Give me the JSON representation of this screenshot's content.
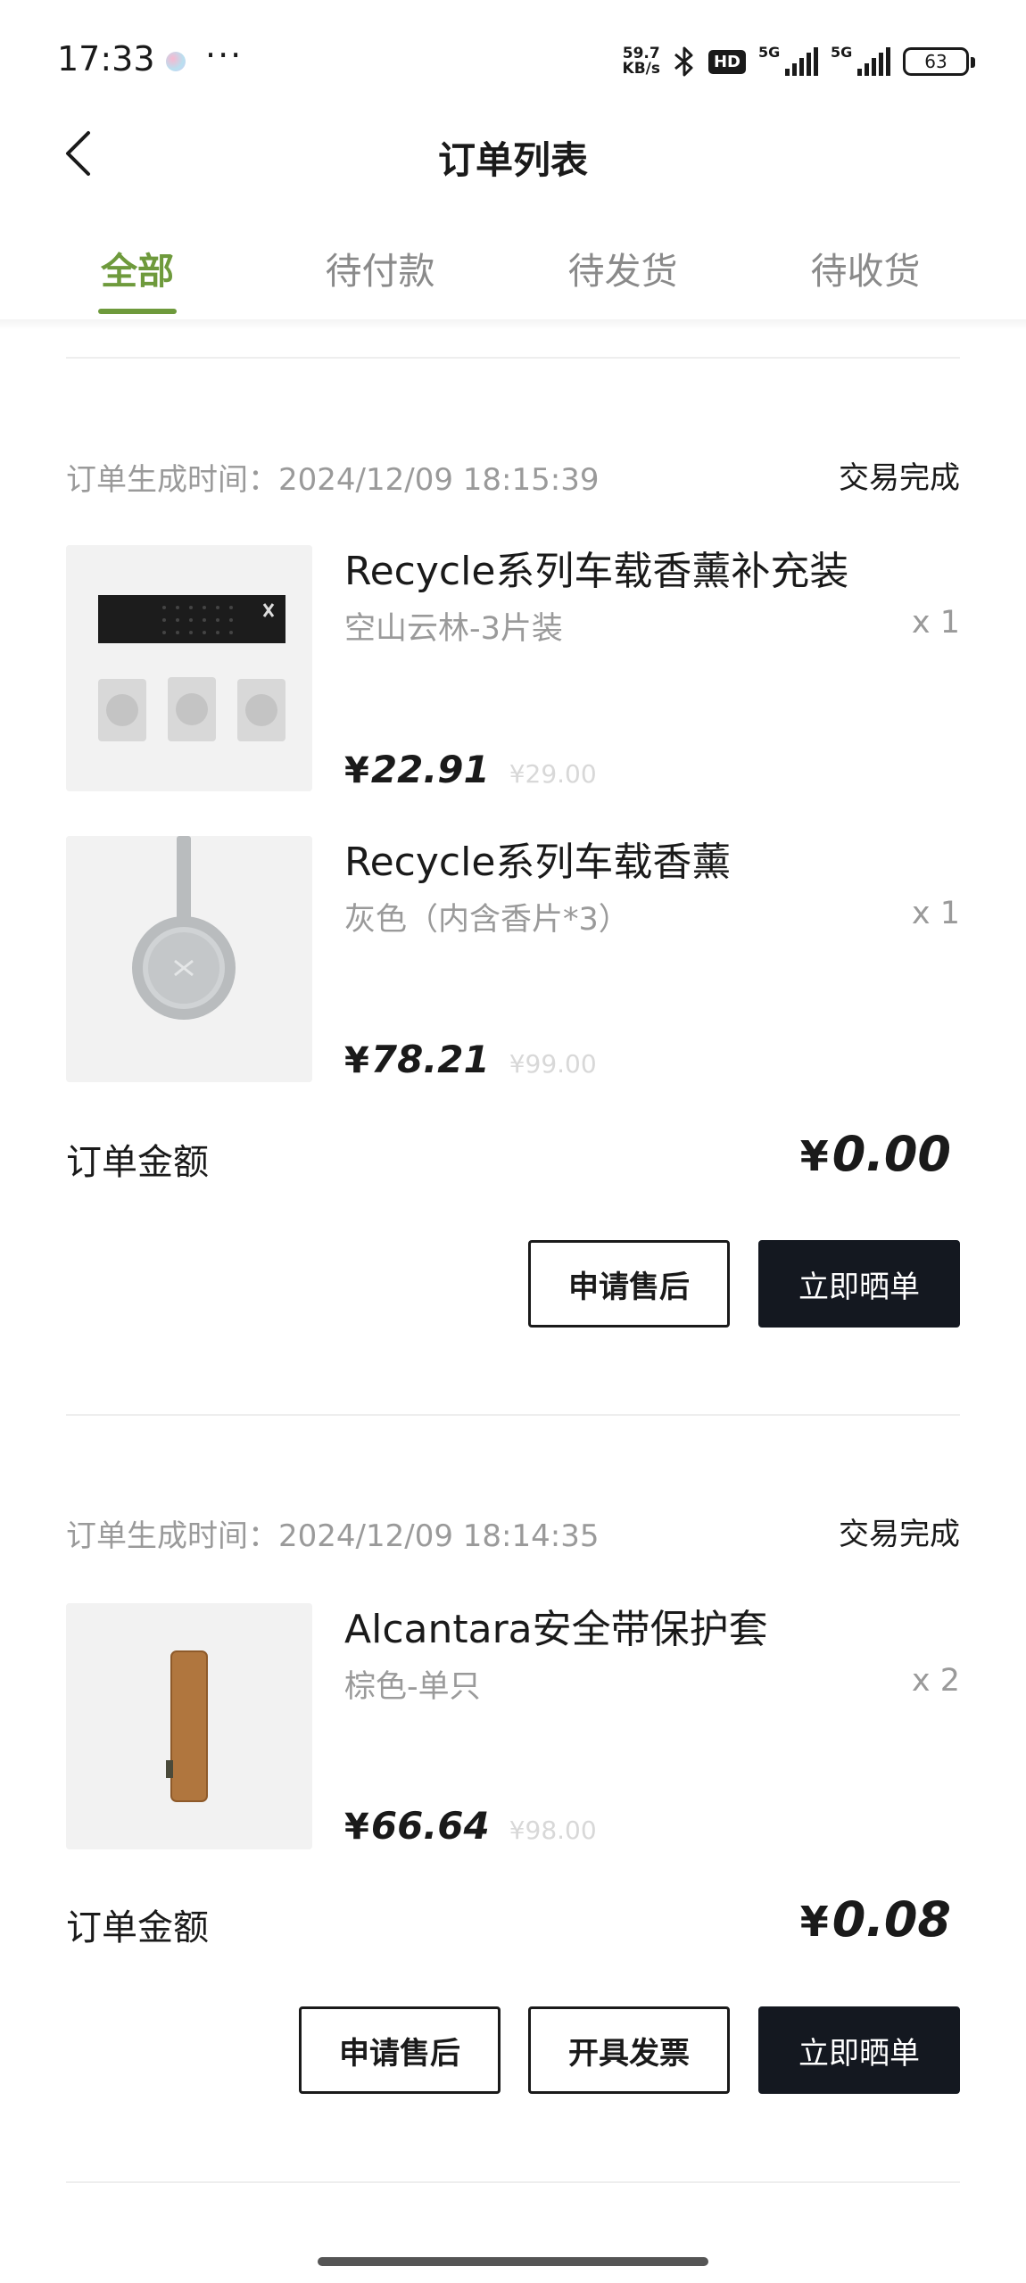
{
  "status_bar": {
    "time": "17:33",
    "speed_value": "59.7",
    "speed_unit": "KB/s",
    "hd": "HD",
    "net1": "5G",
    "net2": "5G",
    "battery": "63"
  },
  "header": {
    "title": "订单列表"
  },
  "tabs": [
    {
      "label": "全部",
      "active": true
    },
    {
      "label": "待付款",
      "active": false
    },
    {
      "label": "待发货",
      "active": false
    },
    {
      "label": "待收货",
      "active": false
    }
  ],
  "orders": [
    {
      "time": "订单生成时间：2024/12/09 18:15:39",
      "status": "交易完成",
      "items": [
        {
          "name": "Recycle系列车载香薰补充装",
          "spec": "空山云林-3片装",
          "qty": "x 1",
          "price": "22.91",
          "original_price": "¥29.00"
        },
        {
          "name": "Recycle系列车载香薰",
          "spec": "灰色（内含香片*3）",
          "qty": "x 1",
          "price": "78.21",
          "original_price": "¥99.00"
        }
      ],
      "total_label": "订单金额",
      "total": "0.00",
      "buttons": [
        "申请售后",
        "立即晒单"
      ]
    },
    {
      "time": "订单生成时间：2024/12/09 18:14:35",
      "status": "交易完成",
      "items": [
        {
          "name": "Alcantara安全带保护套",
          "spec": "棕色-单只",
          "qty": "x 2",
          "price": "66.64",
          "original_price": "¥98.00"
        }
      ],
      "total_label": "订单金额",
      "total": "0.08",
      "buttons": [
        "申请售后",
        "开具发票",
        "立即晒单"
      ]
    }
  ],
  "currency_symbol": "¥",
  "colors": {
    "accent": "#6e9a3c",
    "dark_button": "#141820",
    "muted_text": "#9a9a9a"
  }
}
